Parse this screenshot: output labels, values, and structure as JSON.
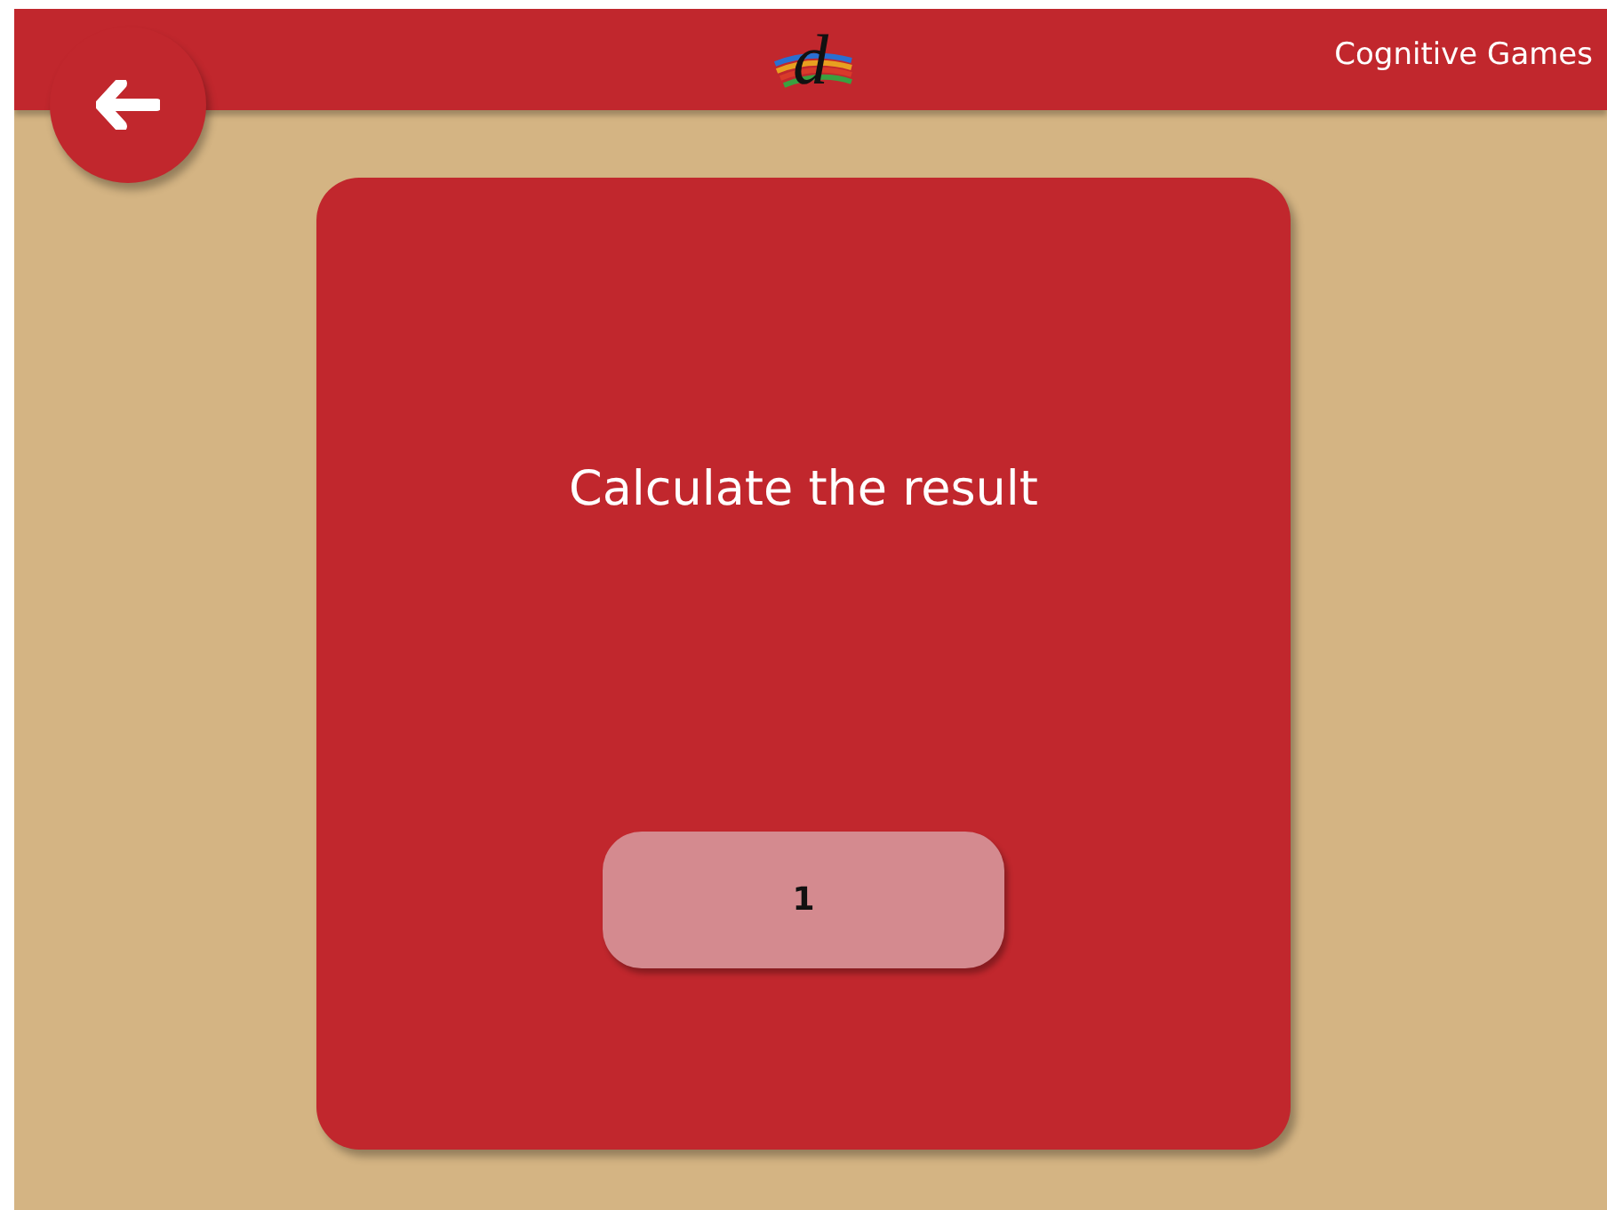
{
  "header": {
    "logo_text": "d",
    "title": "Cognitive Games"
  },
  "card": {
    "prompt": "Calculate the result",
    "answer": "1"
  }
}
